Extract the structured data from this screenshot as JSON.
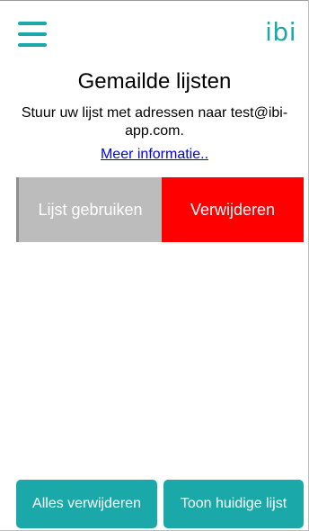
{
  "theme": {
    "accent": "#1ba8a8",
    "link": "#0000ee",
    "use_bg": "#bcbcbc",
    "delete_bg": "#fe0000"
  },
  "header": {
    "menu_icon": "hamburger-menu-icon",
    "logo_text": "ibi"
  },
  "main": {
    "title": "Gemailde lijsten",
    "instruction": "Stuur uw lijst met adressen naar test@ibi-app.com.",
    "more_info_link": "Meer informatie.."
  },
  "list_row": {
    "use_label": "Lijst gebruiken",
    "delete_label": "Verwijderen"
  },
  "footer": {
    "delete_all_label": "Alles verwijderen",
    "show_current_label": "Toon huidige lijst"
  }
}
